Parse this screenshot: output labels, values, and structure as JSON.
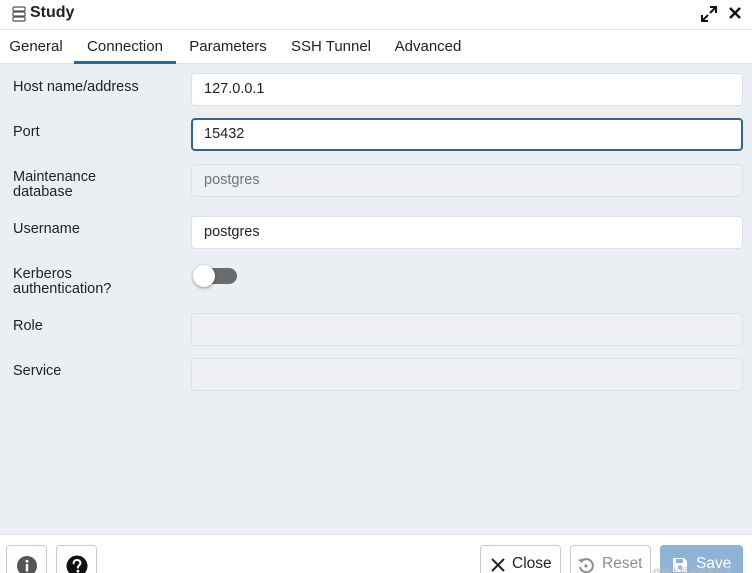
{
  "window": {
    "title": "Study",
    "icons": {
      "app": "server-icon",
      "expand": "expand-icon",
      "close": "close-icon"
    }
  },
  "tabs": [
    {
      "label": "General",
      "active": false
    },
    {
      "label": "Connection",
      "active": true
    },
    {
      "label": "Parameters",
      "active": false
    },
    {
      "label": "SSH Tunnel",
      "active": false
    },
    {
      "label": "Advanced",
      "active": false
    }
  ],
  "form": {
    "host": {
      "label": "Host name/address",
      "value": "127.0.0.1"
    },
    "port": {
      "label": "Port",
      "value": "15432",
      "focused": true
    },
    "maintenance_db": {
      "label_line1": "Maintenance",
      "label_line2": "database",
      "value": "postgres",
      "disabled": true
    },
    "username": {
      "label": "Username",
      "value": "postgres"
    },
    "kerberos": {
      "label_line1": "Kerberos",
      "label_line2": "authentication?",
      "enabled": false
    },
    "role": {
      "label": "Role",
      "value": "",
      "disabled": true
    },
    "service": {
      "label": "Service",
      "value": "",
      "disabled": true
    }
  },
  "footer": {
    "info_icon": "info-icon",
    "help_icon": "help-icon",
    "close_label": "Close",
    "reset_label": "Reset",
    "save_label": "Save"
  },
  "colors": {
    "accent": "#326690",
    "content_bg": "#ebeef3",
    "save_bg": "#8fb3d5"
  },
  "watermark": "@稀土掘金技术社区"
}
